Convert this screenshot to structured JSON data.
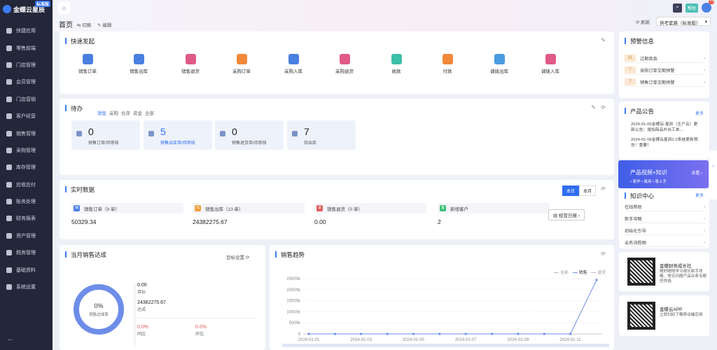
{
  "app": {
    "logo": "金蝶云星辰",
    "edition": "标准版"
  },
  "sidebar": {
    "items": [
      {
        "label": "快捷应用"
      },
      {
        "label": "零售前端"
      },
      {
        "label": "门店管理"
      },
      {
        "label": "会员管理"
      },
      {
        "label": "门店营销"
      },
      {
        "label": "客户经营"
      },
      {
        "label": "销售管理"
      },
      {
        "label": "采购管理"
      },
      {
        "label": "库存管理"
      },
      {
        "label": "应收应付"
      },
      {
        "label": "账务处理"
      },
      {
        "label": "财务报表"
      },
      {
        "label": "资产管理"
      },
      {
        "label": "税务管理"
      },
      {
        "label": "基础资料"
      },
      {
        "label": "系统设置"
      }
    ]
  },
  "topbar": {
    "help": "帮助",
    "notif_count": "73"
  },
  "header": {
    "title": "首页",
    "switch": "切换",
    "edit": "编辑",
    "refresh": "刷新",
    "scheme": "供考套路（标准版）"
  },
  "quick": {
    "title": "快速发起",
    "items": [
      {
        "label": "销售订单",
        "color": "#4a7fe0"
      },
      {
        "label": "销售出库",
        "color": "#4a7fe0"
      },
      {
        "label": "销售退货",
        "color": "#e05a86"
      },
      {
        "label": "采购订单",
        "color": "#f08a3a"
      },
      {
        "label": "采购入库",
        "color": "#4a7fe0"
      },
      {
        "label": "采购退货",
        "color": "#e05a86"
      },
      {
        "label": "收款",
        "color": "#3cbfa8"
      },
      {
        "label": "付款",
        "color": "#f08a3a"
      },
      {
        "label": "调拨出库",
        "color": "#4a9ae0"
      },
      {
        "label": "调拨入库",
        "color": "#e05a86"
      }
    ]
  },
  "todo": {
    "title": "待办",
    "tabs": [
      "销售",
      "采购",
      "仓存",
      "资金",
      "全部"
    ],
    "cards": [
      {
        "num": "0",
        "label": "销售订单/待审核"
      },
      {
        "num": "5",
        "label": "销售出库单/待审核"
      },
      {
        "num": "0",
        "label": "销售退货单/待审核"
      },
      {
        "num": "7",
        "label": "待出库"
      }
    ]
  },
  "realtime": {
    "title": "实时数据",
    "today": "本日",
    "month": "本月",
    "report": "经营日报",
    "stats": [
      {
        "label": "销售订单（9 单）",
        "value": "50329.34",
        "color": "#4a7fe0",
        "ico": "销"
      },
      {
        "label": "销售出库（13 单）",
        "value": "24382275.67",
        "color": "#f0a03a",
        "ico": "出"
      },
      {
        "label": "销售退货（0 单）",
        "value": "0.00",
        "color": "#e05a5a",
        "ico": "退"
      },
      {
        "label": "新增客户",
        "value": "2",
        "color": "#3cbf78",
        "ico": "客"
      }
    ]
  },
  "monthly": {
    "title": "当月销售达成",
    "setting": "目标设置",
    "pct": "0%",
    "pct_label": "销售达成率",
    "target_val": "0.00",
    "target_lbl": "目标",
    "achieved_val": "24382275.67",
    "achieved_lbl": "达成",
    "yoy_val": "0.0%",
    "yoy_lbl": "同比",
    "mom_val": "0.0%",
    "mom_lbl": "环比"
  },
  "trend": {
    "title": "销售趋势",
    "legend": [
      "全部",
      "销售",
      "退货"
    ]
  },
  "chart_data": {
    "type": "line",
    "x": [
      "2024-01-01",
      "2024-01-02",
      "2024-01-03",
      "2024-01-04",
      "2024-01-05",
      "2024-01-06",
      "2024-01-07",
      "2024-01-08",
      "2024-01-09",
      "2024-01-10",
      "2024-01-11",
      "2024-01-12"
    ],
    "x_ticks": [
      "2024-01-01",
      "2024-01-03",
      "2024-01-05",
      "2024-01-07",
      "2024-01-09",
      "2024-01-11"
    ],
    "series": [
      {
        "name": "销售",
        "values": [
          0,
          0,
          0,
          0,
          0,
          0,
          0,
          0,
          0,
          0,
          0,
          24382276
        ]
      }
    ],
    "yticks": [
      "0",
      "5000k",
      "10000k",
      "15000k",
      "20000k",
      "25000k"
    ],
    "ylim": [
      0,
      25000000
    ],
    "color": "#6d8ee8"
  },
  "alerts": {
    "title": "预警信息",
    "items": [
      {
        "num": "31",
        "label": "过期商品"
      },
      {
        "num": "7",
        "label": "采购订单交期预警"
      },
      {
        "num": "7",
        "label": "销售订单交期预警"
      }
    ]
  },
  "notice": {
    "title": "产品公告",
    "more": "更多",
    "items": [
      {
        "text": "2024-01-05金蝶云-星辰（生产云）更新公告：增加商品外出工单..."
      },
      {
        "text": "2024-01-09金蝶云星辰2.0系统更新预告！重要！"
      }
    ]
  },
  "banner": {
    "title": "产品视频+知识",
    "sub": "• 易学 • 易用 • 易上手",
    "link": "去看"
  },
  "knowledge": {
    "title": "知识中心",
    "more": "更多",
    "items": [
      {
        "label": "在线帮助"
      },
      {
        "label": "新手攻略"
      },
      {
        "label": "初始化引导"
      },
      {
        "label": "业务流程图"
      }
    ]
  },
  "qr1": {
    "title": "金蝶财务成长社",
    "desc": "随时随地学习成长新手攻略、常见问题产品业务专题任你选"
  },
  "qr2": {
    "title": "金蝶云APP",
    "desc": "立即扫码下载移动端应用"
  }
}
